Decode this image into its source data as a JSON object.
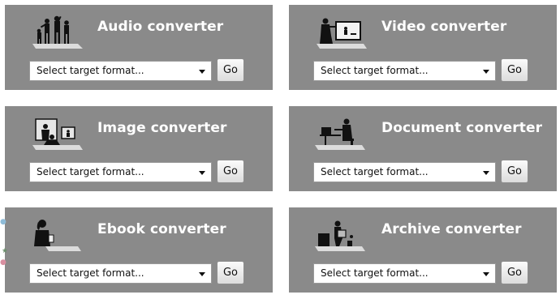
{
  "converters": [
    {
      "title": "Audio converter",
      "select_value": "Select target format...",
      "go_label": "Go"
    },
    {
      "title": "Video converter",
      "select_value": "Select target format...",
      "go_label": "Go"
    },
    {
      "title": "Image converter",
      "select_value": "Select target format...",
      "go_label": "Go"
    },
    {
      "title": "Document converter",
      "select_value": "Select target format...",
      "go_label": "Go"
    },
    {
      "title": "Ebook converter",
      "select_value": "Select target format...",
      "go_label": "Go"
    },
    {
      "title": "Archive converter",
      "select_value": "Select target format...",
      "go_label": "Go"
    }
  ],
  "colors": {
    "card_background": "#8a8a8a",
    "title_text": "#ffffff"
  },
  "icons": [
    "dancers-icon",
    "film-screen-icon",
    "picture-frames-icon",
    "desk-worker-icon",
    "ebook-reader-icon",
    "box-carrier-icon"
  ]
}
